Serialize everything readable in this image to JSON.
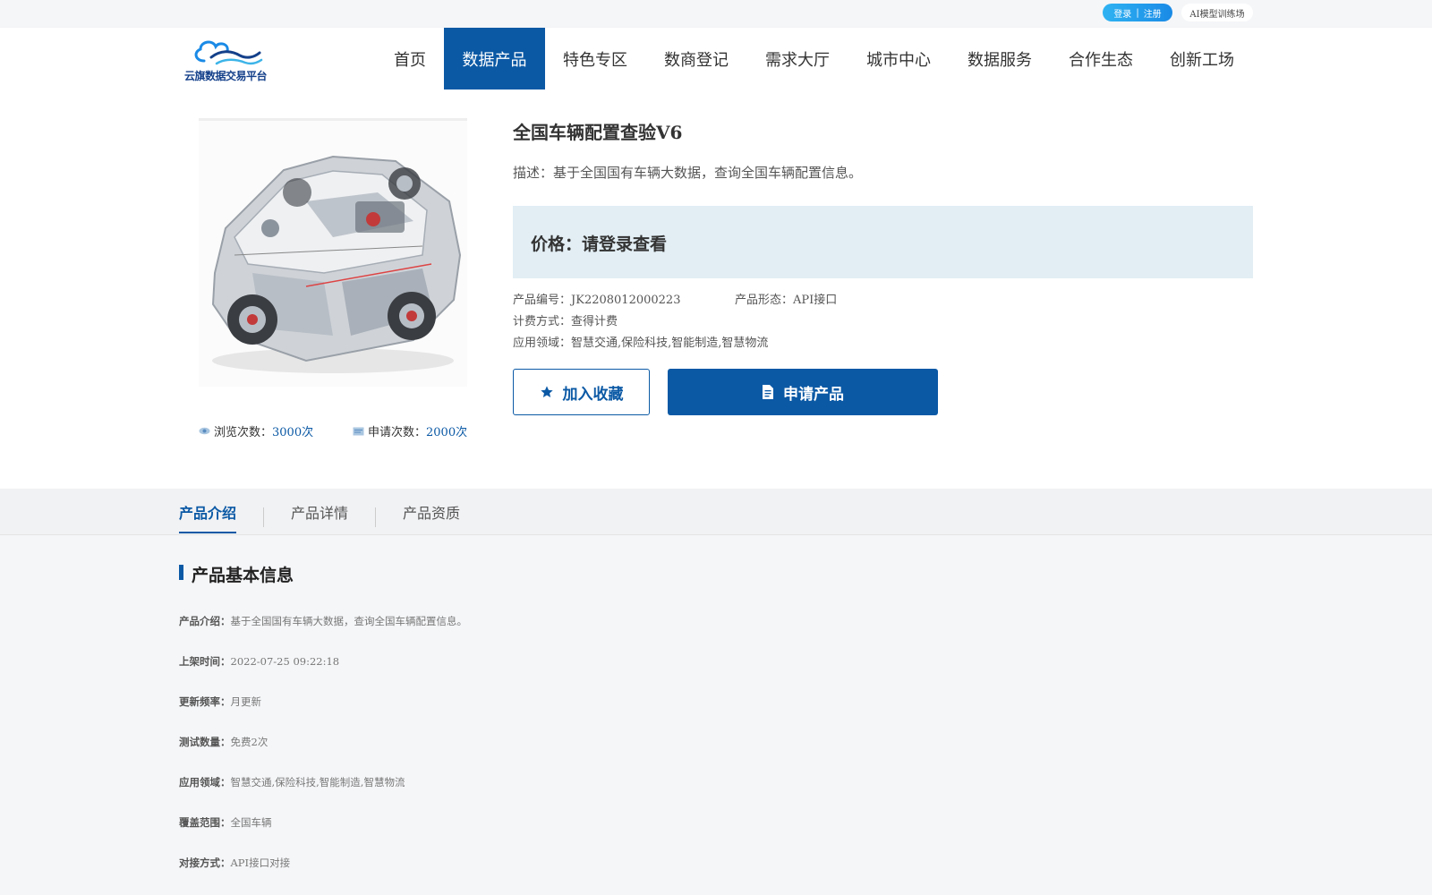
{
  "topbar": {
    "login": "登录",
    "divider": "|",
    "register": "注册",
    "ai_link": "AI模型训练场"
  },
  "logo": {
    "text": "云旗数据交易平台"
  },
  "nav": [
    {
      "label": "首页",
      "active": false
    },
    {
      "label": "数据产品",
      "active": true
    },
    {
      "label": "特色专区",
      "active": false
    },
    {
      "label": "数商登记",
      "active": false
    },
    {
      "label": "需求大厅",
      "active": false
    },
    {
      "label": "城市中心",
      "active": false
    },
    {
      "label": "数据服务",
      "active": false
    },
    {
      "label": "合作生态",
      "active": false
    },
    {
      "label": "创新工场",
      "active": false
    }
  ],
  "product": {
    "title": "全国车辆配置查验V6",
    "description": "描述：基于全国国有车辆大数据，查询全国车辆配置信息。",
    "price": "价格：请登录查看",
    "code_label": "产品编号：",
    "code": "JK2208012000223",
    "form_label": "产品形态：",
    "form": "API接口",
    "billing_label": "计费方式：",
    "billing": "查得计费",
    "domain_label": "应用领域：",
    "domain": "智慧交通,保险科技,智能制造,智慧物流",
    "views_label": "浏览次数：",
    "views": "3000次",
    "applies_label": "申请次数：",
    "applies": "2000次",
    "favorite_button": "加入收藏",
    "apply_button": "申请产品"
  },
  "tabs": [
    {
      "label": "产品介绍",
      "active": true
    },
    {
      "label": "产品详情",
      "active": false
    },
    {
      "label": "产品资质",
      "active": false
    }
  ],
  "basic_info": {
    "title": "产品基本信息",
    "rows": [
      {
        "label": "产品介绍：",
        "value": "基于全国国有车辆大数据，查询全国车辆配置信息。"
      },
      {
        "label": "上架时间：",
        "value": "2022-07-25 09:22:18"
      },
      {
        "label": "更新频率：",
        "value": "月更新"
      },
      {
        "label": "测试数量：",
        "value": "免费2次"
      },
      {
        "label": "应用领域：",
        "value": "智慧交通,保险科技,智能制造,智慧物流"
      },
      {
        "label": "覆盖范围：",
        "value": "全国车辆"
      },
      {
        "label": "对接方式：",
        "value": "API接口对接"
      }
    ]
  },
  "colors": {
    "primary": "#0b59a5",
    "price_bg": "#e2eef4",
    "pill_from": "#2fb3f2",
    "pill_to": "#1a8ae6"
  },
  "icons": {
    "views": "eye-icon",
    "applies": "form-icon",
    "favorite": "star-icon",
    "apply": "document-icon"
  }
}
